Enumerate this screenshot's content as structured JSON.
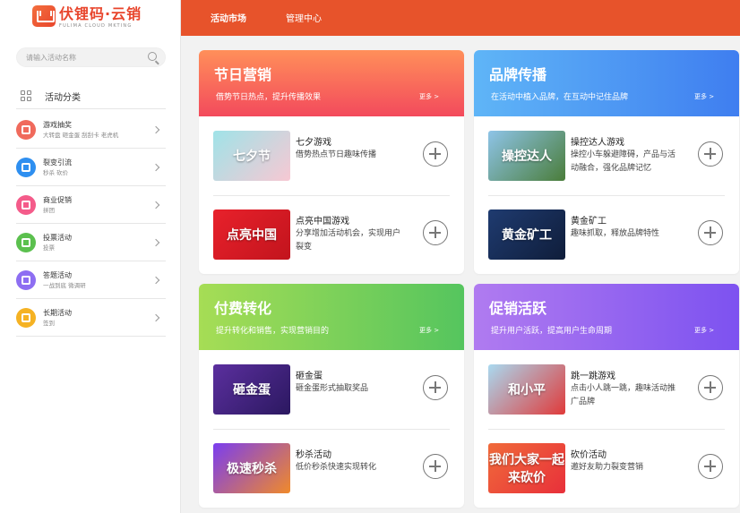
{
  "brand": {
    "title": "伏锂码·云销",
    "subtitle": "FULIMA  CLOUD  MKTING"
  },
  "search": {
    "placeholder": "请输入活动名称"
  },
  "topnav": [
    {
      "label": "活动市场",
      "active": true
    },
    {
      "label": "管理中心",
      "active": false
    }
  ],
  "sidebar": {
    "heading": "活动分类",
    "items": [
      {
        "title": "游戏抽奖",
        "desc": "大转盘 砸金蛋 刮刮卡 老虎机",
        "color": "#f06a5c"
      },
      {
        "title": "裂变引流",
        "desc": "秒杀 砍价",
        "color": "#2e8ff0"
      },
      {
        "title": "商业促销",
        "desc": "拼团",
        "color": "#f45b8a"
      },
      {
        "title": "投票活动",
        "desc": "投票",
        "color": "#5bc04e"
      },
      {
        "title": "答题活动",
        "desc": "一战到底 微调研",
        "color": "#8d6ef2"
      },
      {
        "title": "长期活动",
        "desc": "签到",
        "color": "#f5b223"
      }
    ]
  },
  "cards": [
    {
      "title": "节日营销",
      "desc": "借势节日热点，提升传播效果",
      "more": "更多 >",
      "gradient": [
        "#ff8f5a",
        "#f34a5c"
      ],
      "games": [
        {
          "name": "七夕游戏",
          "desc": "借势热点节日趣味传播",
          "thumb_text": "七夕节",
          "thumb_colors": [
            "#9fe3e8",
            "#f7c8d3"
          ]
        },
        {
          "name": "点亮中国游戏",
          "desc": "分享增加活动机会，实现用户裂变",
          "thumb_text": "点亮中国",
          "thumb_colors": [
            "#e8212b",
            "#c2141d"
          ]
        }
      ]
    },
    {
      "title": "品牌传播",
      "desc": "在活动中植入品牌，在互动中记住品牌",
      "more": "更多 >",
      "gradient": [
        "#5fb5f7",
        "#3f7ef0"
      ],
      "games": [
        {
          "name": "操控达人游戏",
          "desc": "操控小车躲避障碍，产品与活动融合，强化品牌记忆",
          "thumb_text": "操控达人",
          "thumb_colors": [
            "#8ec4e8",
            "#4a7d3a"
          ]
        },
        {
          "name": "黄金矿工",
          "desc": "趣味抓取，释放品牌特性",
          "thumb_text": "黄金矿工",
          "thumb_colors": [
            "#1f3b70",
            "#0f1d3a"
          ]
        }
      ]
    },
    {
      "title": "付费转化",
      "desc": "提升转化和销售，实现营销目的",
      "more": "更多 >",
      "gradient": [
        "#a6dd55",
        "#55c55e"
      ],
      "games": [
        {
          "name": "砸金蛋",
          "desc": "砸金蛋形式抽取奖品",
          "thumb_text": "砸金蛋",
          "thumb_colors": [
            "#5b2f9e",
            "#2b1860"
          ]
        },
        {
          "name": "秒杀活动",
          "desc": "低价秒杀快速实现转化",
          "thumb_text": "极速秒杀",
          "thumb_colors": [
            "#7a3df0",
            "#f08a2a"
          ]
        }
      ]
    },
    {
      "title": "促销活跃",
      "desc": "提升用户活跃，提高用户生命周期",
      "more": "更多 >",
      "gradient": [
        "#b07bf0",
        "#7d52f0"
      ],
      "games": [
        {
          "name": "跳一跳游戏",
          "desc": "点击小人跳一跳，趣味活动推广品牌",
          "thumb_text": "和小平",
          "thumb_colors": [
            "#a9d9f0",
            "#e03a3a"
          ]
        },
        {
          "name": "砍价活动",
          "desc": "邀好友助力裂变营销",
          "thumb_text": "我们大家一起来砍价",
          "thumb_colors": [
            "#f06a3a",
            "#e8303a"
          ]
        }
      ]
    }
  ]
}
